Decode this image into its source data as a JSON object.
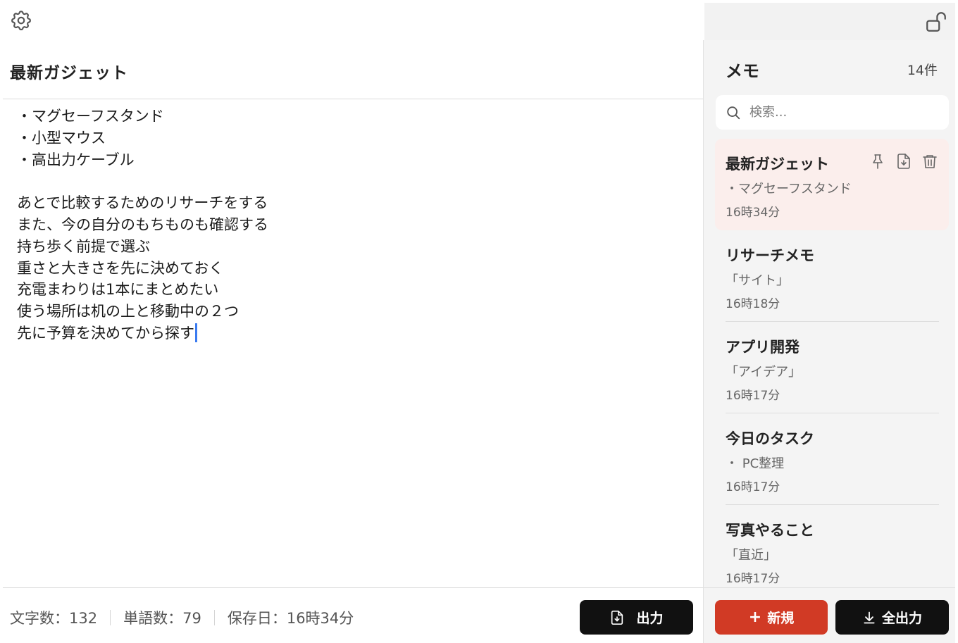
{
  "editor": {
    "title": "最新ガジェット",
    "lines": [
      "・マグセーフスタンド",
      "・小型マウス",
      "・高出力ケーブル",
      "",
      "あとで比較するためのリサーチをする",
      "また、今の自分のもちものも確認する",
      "持ち歩く前提で選ぶ",
      "重さと大きさを先に決めておく",
      "充電まわりは1本にまとめたい",
      "使う場所は机の上と移動中の２つ",
      "先に予算を決めてから探す"
    ],
    "stats": {
      "chars": "文字数：132",
      "words": "単語数：79",
      "saved": "保存日：16時34分"
    },
    "export_label": "出力"
  },
  "sidebar": {
    "title": "メモ",
    "count": "14件",
    "search_placeholder": "検索...",
    "items": [
      {
        "title": "最新ガジェット",
        "preview": "・マグセーフスタンド",
        "date": "16時34分"
      },
      {
        "title": "リサーチメモ",
        "preview": "「サイト」",
        "date": "16時18分"
      },
      {
        "title": "アプリ開発",
        "preview": "「アイデア」",
        "date": "16時17分"
      },
      {
        "title": "今日のタスク",
        "preview": "・ PC整理",
        "date": "16時17分"
      },
      {
        "title": "写真やること",
        "preview": "「直近」",
        "date": "16時17分"
      }
    ],
    "new_label": "新規",
    "export_all_label": "全出力"
  },
  "icons": {
    "settings": "gear-icon",
    "lock": "unlock-icon",
    "search": "search-icon",
    "pin": "pin-icon",
    "download": "file-download-icon",
    "trash": "trash-icon",
    "plus": "plus-icon",
    "download_arrow": "download-arrow-icon"
  },
  "colors": {
    "accent_red": "#d13a25",
    "caret_blue": "#3b7bf0",
    "active_item_bg": "#fbeeec"
  }
}
